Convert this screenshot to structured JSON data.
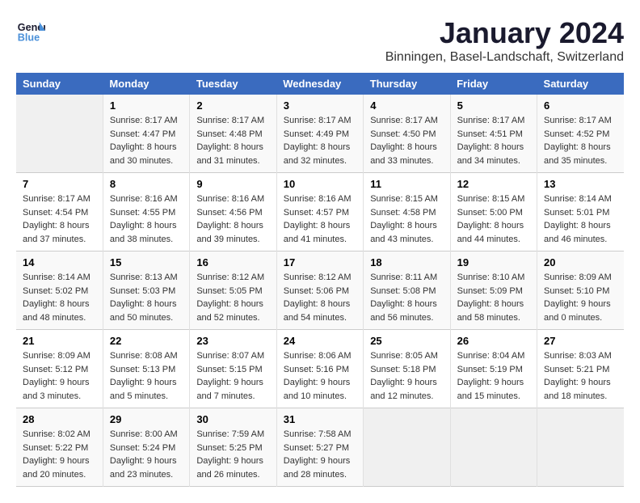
{
  "logo": {
    "text_general": "General",
    "text_blue": "Blue"
  },
  "header": {
    "title": "January 2024",
    "subtitle": "Binningen, Basel-Landschaft, Switzerland"
  },
  "weekdays": [
    "Sunday",
    "Monday",
    "Tuesday",
    "Wednesday",
    "Thursday",
    "Friday",
    "Saturday"
  ],
  "weeks": [
    [
      {
        "day": "",
        "sunrise": "",
        "sunset": "",
        "daylight": "",
        "empty": true
      },
      {
        "day": "1",
        "sunrise": "Sunrise: 8:17 AM",
        "sunset": "Sunset: 4:47 PM",
        "daylight": "Daylight: 8 hours and 30 minutes."
      },
      {
        "day": "2",
        "sunrise": "Sunrise: 8:17 AM",
        "sunset": "Sunset: 4:48 PM",
        "daylight": "Daylight: 8 hours and 31 minutes."
      },
      {
        "day": "3",
        "sunrise": "Sunrise: 8:17 AM",
        "sunset": "Sunset: 4:49 PM",
        "daylight": "Daylight: 8 hours and 32 minutes."
      },
      {
        "day": "4",
        "sunrise": "Sunrise: 8:17 AM",
        "sunset": "Sunset: 4:50 PM",
        "daylight": "Daylight: 8 hours and 33 minutes."
      },
      {
        "day": "5",
        "sunrise": "Sunrise: 8:17 AM",
        "sunset": "Sunset: 4:51 PM",
        "daylight": "Daylight: 8 hours and 34 minutes."
      },
      {
        "day": "6",
        "sunrise": "Sunrise: 8:17 AM",
        "sunset": "Sunset: 4:52 PM",
        "daylight": "Daylight: 8 hours and 35 minutes."
      }
    ],
    [
      {
        "day": "7",
        "sunrise": "Sunrise: 8:17 AM",
        "sunset": "Sunset: 4:54 PM",
        "daylight": "Daylight: 8 hours and 37 minutes."
      },
      {
        "day": "8",
        "sunrise": "Sunrise: 8:16 AM",
        "sunset": "Sunset: 4:55 PM",
        "daylight": "Daylight: 8 hours and 38 minutes."
      },
      {
        "day": "9",
        "sunrise": "Sunrise: 8:16 AM",
        "sunset": "Sunset: 4:56 PM",
        "daylight": "Daylight: 8 hours and 39 minutes."
      },
      {
        "day": "10",
        "sunrise": "Sunrise: 8:16 AM",
        "sunset": "Sunset: 4:57 PM",
        "daylight": "Daylight: 8 hours and 41 minutes."
      },
      {
        "day": "11",
        "sunrise": "Sunrise: 8:15 AM",
        "sunset": "Sunset: 4:58 PM",
        "daylight": "Daylight: 8 hours and 43 minutes."
      },
      {
        "day": "12",
        "sunrise": "Sunrise: 8:15 AM",
        "sunset": "Sunset: 5:00 PM",
        "daylight": "Daylight: 8 hours and 44 minutes."
      },
      {
        "day": "13",
        "sunrise": "Sunrise: 8:14 AM",
        "sunset": "Sunset: 5:01 PM",
        "daylight": "Daylight: 8 hours and 46 minutes."
      }
    ],
    [
      {
        "day": "14",
        "sunrise": "Sunrise: 8:14 AM",
        "sunset": "Sunset: 5:02 PM",
        "daylight": "Daylight: 8 hours and 48 minutes."
      },
      {
        "day": "15",
        "sunrise": "Sunrise: 8:13 AM",
        "sunset": "Sunset: 5:03 PM",
        "daylight": "Daylight: 8 hours and 50 minutes."
      },
      {
        "day": "16",
        "sunrise": "Sunrise: 8:12 AM",
        "sunset": "Sunset: 5:05 PM",
        "daylight": "Daylight: 8 hours and 52 minutes."
      },
      {
        "day": "17",
        "sunrise": "Sunrise: 8:12 AM",
        "sunset": "Sunset: 5:06 PM",
        "daylight": "Daylight: 8 hours and 54 minutes."
      },
      {
        "day": "18",
        "sunrise": "Sunrise: 8:11 AM",
        "sunset": "Sunset: 5:08 PM",
        "daylight": "Daylight: 8 hours and 56 minutes."
      },
      {
        "day": "19",
        "sunrise": "Sunrise: 8:10 AM",
        "sunset": "Sunset: 5:09 PM",
        "daylight": "Daylight: 8 hours and 58 minutes."
      },
      {
        "day": "20",
        "sunrise": "Sunrise: 8:09 AM",
        "sunset": "Sunset: 5:10 PM",
        "daylight": "Daylight: 9 hours and 0 minutes."
      }
    ],
    [
      {
        "day": "21",
        "sunrise": "Sunrise: 8:09 AM",
        "sunset": "Sunset: 5:12 PM",
        "daylight": "Daylight: 9 hours and 3 minutes."
      },
      {
        "day": "22",
        "sunrise": "Sunrise: 8:08 AM",
        "sunset": "Sunset: 5:13 PM",
        "daylight": "Daylight: 9 hours and 5 minutes."
      },
      {
        "day": "23",
        "sunrise": "Sunrise: 8:07 AM",
        "sunset": "Sunset: 5:15 PM",
        "daylight": "Daylight: 9 hours and 7 minutes."
      },
      {
        "day": "24",
        "sunrise": "Sunrise: 8:06 AM",
        "sunset": "Sunset: 5:16 PM",
        "daylight": "Daylight: 9 hours and 10 minutes."
      },
      {
        "day": "25",
        "sunrise": "Sunrise: 8:05 AM",
        "sunset": "Sunset: 5:18 PM",
        "daylight": "Daylight: 9 hours and 12 minutes."
      },
      {
        "day": "26",
        "sunrise": "Sunrise: 8:04 AM",
        "sunset": "Sunset: 5:19 PM",
        "daylight": "Daylight: 9 hours and 15 minutes."
      },
      {
        "day": "27",
        "sunrise": "Sunrise: 8:03 AM",
        "sunset": "Sunset: 5:21 PM",
        "daylight": "Daylight: 9 hours and 18 minutes."
      }
    ],
    [
      {
        "day": "28",
        "sunrise": "Sunrise: 8:02 AM",
        "sunset": "Sunset: 5:22 PM",
        "daylight": "Daylight: 9 hours and 20 minutes."
      },
      {
        "day": "29",
        "sunrise": "Sunrise: 8:00 AM",
        "sunset": "Sunset: 5:24 PM",
        "daylight": "Daylight: 9 hours and 23 minutes."
      },
      {
        "day": "30",
        "sunrise": "Sunrise: 7:59 AM",
        "sunset": "Sunset: 5:25 PM",
        "daylight": "Daylight: 9 hours and 26 minutes."
      },
      {
        "day": "31",
        "sunrise": "Sunrise: 7:58 AM",
        "sunset": "Sunset: 5:27 PM",
        "daylight": "Daylight: 9 hours and 28 minutes."
      },
      {
        "day": "",
        "sunrise": "",
        "sunset": "",
        "daylight": "",
        "empty": true
      },
      {
        "day": "",
        "sunrise": "",
        "sunset": "",
        "daylight": "",
        "empty": true
      },
      {
        "day": "",
        "sunrise": "",
        "sunset": "",
        "daylight": "",
        "empty": true
      }
    ]
  ]
}
